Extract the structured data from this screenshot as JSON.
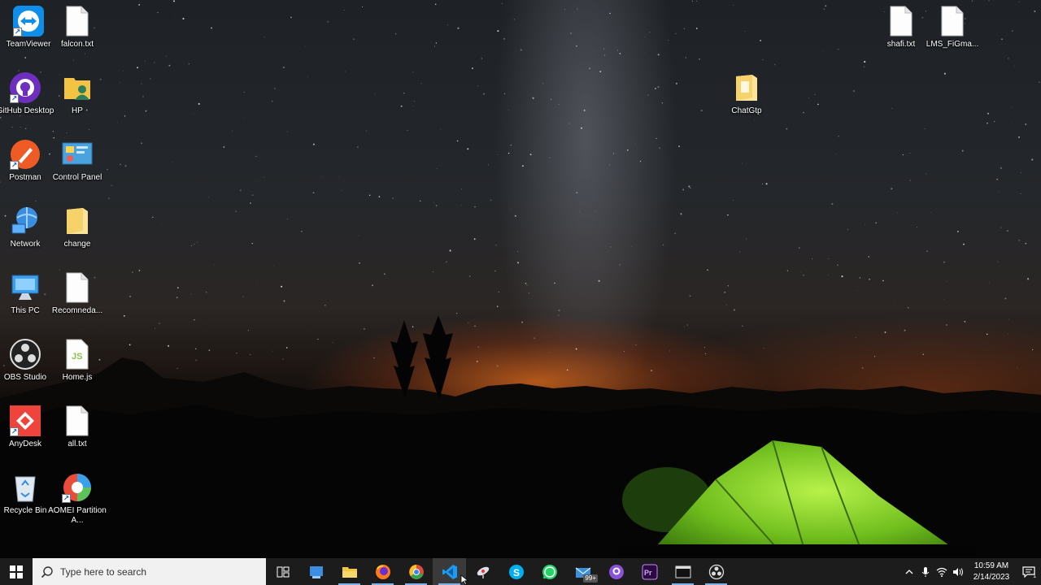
{
  "desktop": {
    "icons": [
      {
        "label": "TeamViewer",
        "icon": "teamviewer-icon"
      },
      {
        "label": "falcon.txt",
        "icon": "text-file-icon"
      },
      {
        "label": "GitHub Desktop",
        "icon": "github-desktop-icon"
      },
      {
        "label": "HP",
        "icon": "user-folder-icon"
      },
      {
        "label": "Postman",
        "icon": "postman-icon"
      },
      {
        "label": "Control Panel",
        "icon": "control-panel-icon"
      },
      {
        "label": "Network",
        "icon": "network-icon"
      },
      {
        "label": "change",
        "icon": "folder-icon"
      },
      {
        "label": "This PC",
        "icon": "this-pc-icon"
      },
      {
        "label": "Recomneda...",
        "icon": "text-file-icon"
      },
      {
        "label": "OBS Studio",
        "icon": "obs-icon"
      },
      {
        "label": "Home.js",
        "icon": "js-file-icon"
      },
      {
        "label": "AnyDesk",
        "icon": "anydesk-icon"
      },
      {
        "label": "all.txt",
        "icon": "text-file-icon"
      },
      {
        "label": "Recycle Bin",
        "icon": "recycle-bin-icon"
      },
      {
        "label": "AOMEI Partition A...",
        "icon": "aomei-icon"
      },
      {
        "label": "ChatGtp",
        "icon": "folder-icon"
      },
      {
        "label": "shafi.txt",
        "icon": "text-file-icon"
      },
      {
        "label": "LMS_FiGma...",
        "icon": "text-file-icon"
      }
    ]
  },
  "taskbar": {
    "search_placeholder": "Type here to search",
    "apps": [
      {
        "name": "task-view",
        "icon": "task-view-icon"
      },
      {
        "name": "cortana-app",
        "icon": "app-icon"
      },
      {
        "name": "file-explorer",
        "icon": "folder-icon"
      },
      {
        "name": "firefox",
        "icon": "firefox-icon"
      },
      {
        "name": "chrome",
        "icon": "chrome-icon"
      },
      {
        "name": "vscode",
        "icon": "vscode-icon"
      },
      {
        "name": "satellite-app",
        "icon": "satellite-icon"
      },
      {
        "name": "skype",
        "icon": "skype-icon"
      },
      {
        "name": "whatsapp",
        "icon": "whatsapp-icon"
      },
      {
        "name": "mail",
        "icon": "mail-icon",
        "badge": "99+"
      },
      {
        "name": "github-desktop",
        "icon": "github-icon"
      },
      {
        "name": "premiere-pro",
        "icon": "premiere-icon"
      },
      {
        "name": "terminal",
        "icon": "terminal-icon"
      },
      {
        "name": "obs-studio",
        "icon": "obs-icon"
      }
    ],
    "clock": {
      "time": "10:59 AM",
      "date": "2/14/2023"
    },
    "notification_count": "1"
  },
  "colors": {
    "taskbar": "#1c1c1c",
    "search_bg": "#f1f1f1",
    "running_indicator": "#7fb2e6"
  }
}
